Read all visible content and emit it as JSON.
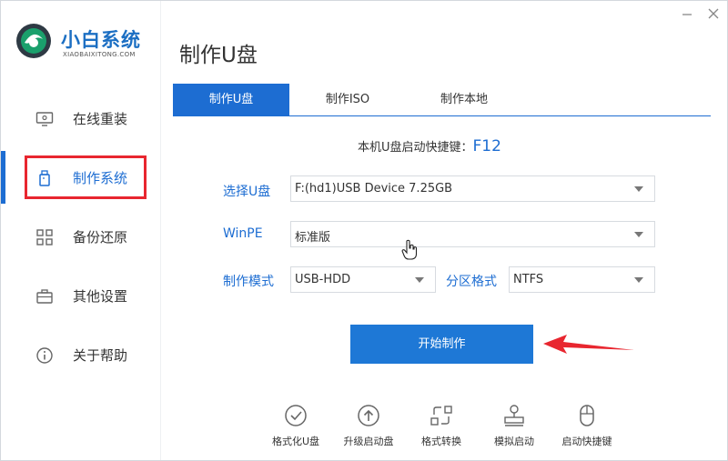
{
  "brand": {
    "name": "小白系统",
    "subtitle": "XIAOBAIXITONG.COM"
  },
  "sidebar": {
    "items": [
      {
        "label": "在线重装",
        "icon": "monitor-icon"
      },
      {
        "label": "制作系统",
        "icon": "usb-drive-icon",
        "active": true
      },
      {
        "label": "备份还原",
        "icon": "grid-icon"
      },
      {
        "label": "其他设置",
        "icon": "briefcase-icon"
      },
      {
        "label": "关于帮助",
        "icon": "info-icon"
      }
    ]
  },
  "page": {
    "title": "制作U盘"
  },
  "tabs": [
    {
      "label": "制作U盘",
      "active": true
    },
    {
      "label": "制作ISO"
    },
    {
      "label": "制作本地"
    }
  ],
  "shortcut": {
    "label": "本机U盘启动快捷键：",
    "key": "F12"
  },
  "form": {
    "usb": {
      "label": "选择U盘",
      "value": "F:(hd1)USB Device 7.25GB"
    },
    "winpe": {
      "label": "WinPE",
      "value": "标准版"
    },
    "mode": {
      "label": "制作模式",
      "value": "USB-HDD"
    },
    "partition": {
      "label": "分区格式",
      "value": "NTFS"
    }
  },
  "start_button": {
    "label": "开始制作"
  },
  "tools": [
    {
      "label": "格式化U盘",
      "icon": "check-circle-icon"
    },
    {
      "label": "升级启动盘",
      "icon": "upload-circle-icon"
    },
    {
      "label": "格式转换",
      "icon": "convert-icon"
    },
    {
      "label": "模拟启动",
      "icon": "stamp-icon"
    },
    {
      "label": "启动快捷键",
      "icon": "mouse-icon"
    }
  ],
  "colors": {
    "accent": "#1d6dd2",
    "highlight": "#e8262f",
    "button": "#1e78d6"
  }
}
